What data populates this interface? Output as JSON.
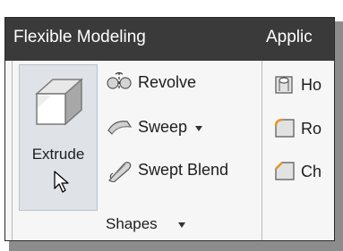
{
  "tabs": {
    "flexible_modeling": "Flexible Modeling",
    "applications_partial": "Applic"
  },
  "shapes_group": {
    "extrude": "Extrude",
    "revolve": "Revolve",
    "sweep": "Sweep",
    "swept_blend": "Swept Blend",
    "group_label": "Shapes"
  },
  "engineering_group_partial": {
    "hole": "Ho",
    "round": "Ro",
    "chamfer": "Ch"
  },
  "colors": {
    "tab_bar": "#3a3a3a",
    "ribbon": "#f6f6f6",
    "selected_button": "#dfe3e8"
  }
}
